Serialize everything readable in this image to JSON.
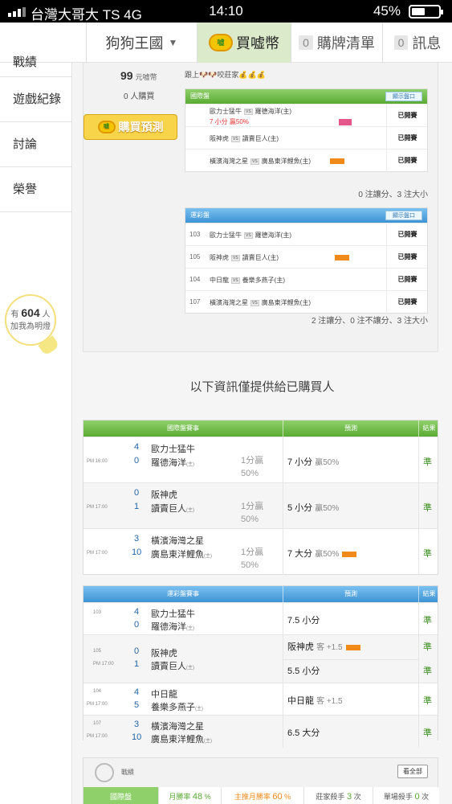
{
  "status": {
    "carrier": "台灣大哥大 TS 4G",
    "time": "14:10",
    "battery": "45%"
  },
  "topnav": {
    "dog_menu": "狗狗王國",
    "buy": "買嘘幣",
    "buy_icon": "嘘",
    "list_label": "購牌清單",
    "list_count": "0",
    "msg_label": "訊息",
    "msg_count": "0"
  },
  "sidebar": {
    "items": [
      "戰績",
      "遊戲紀錄",
      "討論",
      "榮譽"
    ],
    "bulb_prefix": "有",
    "bulb_count": "604",
    "bulb_unit": "人",
    "bulb_text": "加我為明燈"
  },
  "offer": {
    "price": "99",
    "price_unit": "元嘘幣",
    "buyers": "0 人購買",
    "buy_btn": "購買預測",
    "follow_text": "跟上🐶🐶咬莊家💰💰💰"
  },
  "intl_box": {
    "title": "國際盤",
    "show_btn": "顯示盤口",
    "rows": [
      {
        "away": "歐力士猛牛",
        "vs": "VS",
        "home": "羅德海洋(主)",
        "sub": "7 小分  贏50%",
        "state": "已開賽"
      },
      {
        "away": "阪神虎",
        "vs": "VS",
        "home": "讀賣巨人(主)",
        "state": "已開賽"
      },
      {
        "away": "橫濱海灣之星",
        "vs": "VS",
        "home": "廣島東洋鯉魚(主)",
        "state": "已開賽"
      }
    ],
    "summary": "0 注讓分、3 注大小"
  },
  "lottery_box": {
    "title": "運彩盤",
    "show_btn": "顯示盤口",
    "rows": [
      {
        "num": "103",
        "away": "歐力士猛牛",
        "vs": "VS",
        "home": "羅德海洋(主)",
        "state": "已開賽"
      },
      {
        "num": "105",
        "away": "阪神虎",
        "vs": "VS",
        "home": "讀賣巨人(主)",
        "state": "已開賽"
      },
      {
        "num": "104",
        "away": "中日龍",
        "vs": "VS",
        "home": "養樂多燕子(主)",
        "state": "已開賽"
      },
      {
        "num": "107",
        "away": "橫濱海灣之星",
        "vs": "VS",
        "home": "廣島東洋鯉魚(主)",
        "state": "已開賽"
      }
    ],
    "summary": "2 注讓分、0 注不讓分、3 注大小"
  },
  "notice": "以下資訊僅提供給已購買人",
  "intl_table": {
    "h1": "國際盤賽事",
    "h2": "預測",
    "h3": "結果",
    "rows": [
      {
        "time": "PM 16:00",
        "s1": "4",
        "t1": "歐力士猛牛",
        "s2": "0",
        "t2": "羅德海洋",
        "home": "(主)",
        "handicap": "1分贏50%",
        "pred": "7 小分",
        "pct": "贏50%",
        "result": "準"
      },
      {
        "time": "PM 17:00",
        "s1": "0",
        "t1": "阪神虎",
        "s2": "1",
        "t2": "讀賣巨人",
        "home": "(主)",
        "handicap": "1分贏50%",
        "pred": "5 小分",
        "pct": "贏50%",
        "result": "準"
      },
      {
        "time": "PM 17:00",
        "s1": "3",
        "t1": "橫濱海灣之星",
        "s2": "10",
        "t2": "廣島東洋鯉魚",
        "home": "(主)",
        "handicap": "1分贏50%",
        "pred": "7 大分",
        "pct": "贏50%",
        "result": "準"
      }
    ]
  },
  "lottery_table": {
    "h1": "運彩盤賽事",
    "h2": "預測",
    "h3": "結果",
    "rows": [
      {
        "num": "103",
        "s1": "4",
        "t1": "歐力士猛牛",
        "s2": "0",
        "t2": "羅德海洋",
        "home": "(主)",
        "preds": [
          {
            "text": "7.5 小分",
            "result": "準"
          }
        ]
      },
      {
        "num": "105",
        "time": "PM 17:00",
        "s1": "0",
        "t1": "阪神虎",
        "s2": "1",
        "t2": "讀賣巨人",
        "home": "(主)",
        "preds": [
          {
            "text": "阪神虎",
            "tag": "客 +1.5",
            "result": "準"
          },
          {
            "text": "5.5 小分",
            "result": "準"
          }
        ]
      },
      {
        "num": "104",
        "time": "PM 17:00",
        "s1": "4",
        "t1": "中日龍",
        "s2": "5",
        "t2": "養樂多燕子",
        "home": "(主)",
        "preds": [
          {
            "text": "中日龍",
            "tag": "客 +1.5",
            "result": "準"
          }
        ]
      },
      {
        "num": "107",
        "time": "PM 17:00",
        "s1": "3",
        "t1": "橫濱海灣之星",
        "s2": "10",
        "t2": "廣島東洋鯉魚",
        "home": "(主)",
        "preds": [
          {
            "text": "6.5 大分",
            "result": "準"
          }
        ]
      }
    ]
  },
  "stats": {
    "label": "戰績",
    "view_all": "看全部",
    "cells": [
      {
        "label": "國際盤"
      },
      {
        "label": "月勝率",
        "value": "48",
        "unit": "%"
      },
      {
        "label": "主推月勝率",
        "value": "60",
        "unit": "%"
      },
      {
        "label": "莊家殺手",
        "value": "3",
        "unit": "次"
      },
      {
        "label": "單場殺手",
        "value": "0",
        "unit": "次"
      }
    ]
  },
  "colors": {
    "green": "#5aaa33",
    "blue": "#3d93d4",
    "score": "#2365a8",
    "correct": "#3a8d1c",
    "coin": "#f3c400"
  }
}
